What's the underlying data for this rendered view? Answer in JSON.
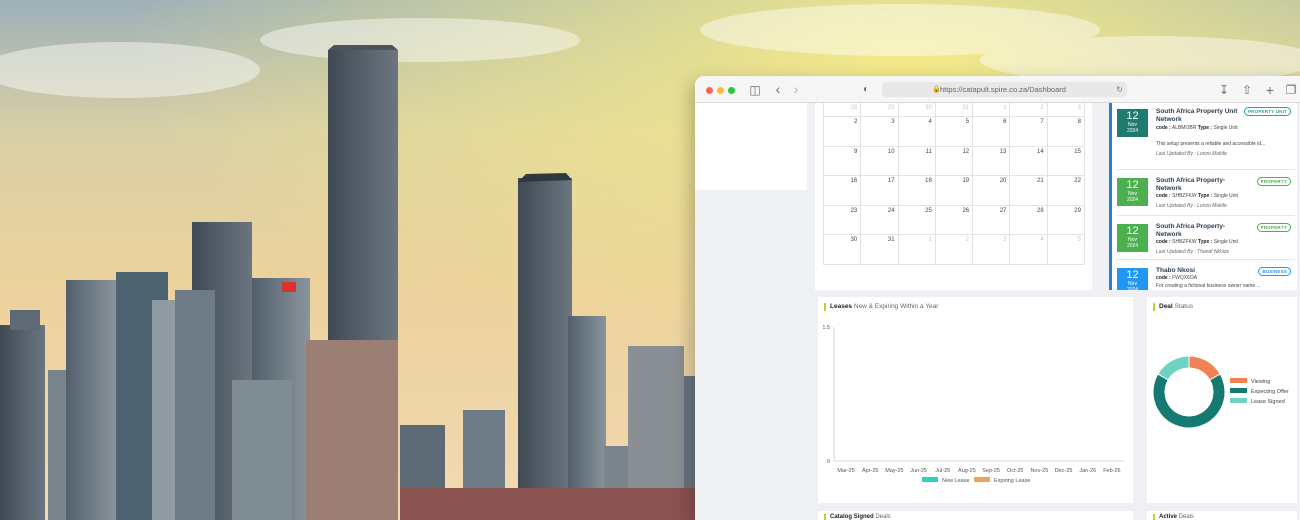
{
  "browser": {
    "url": "https://catapult.spire.co.za/Dashboard",
    "toolbar_icons": [
      "sidebar-icon",
      "back-icon",
      "forward-icon",
      "shield-icon",
      "download-icon",
      "share-icon",
      "plus-icon",
      "tabs-icon"
    ]
  },
  "calendar": {
    "rows": [
      [
        "28",
        "29",
        "30",
        "31",
        "1",
        "2",
        "3"
      ],
      [
        "2",
        "3",
        "4",
        "5",
        "6",
        "7",
        "8"
      ],
      [
        "9",
        "10",
        "11",
        "12",
        "13",
        "14",
        "15"
      ],
      [
        "16",
        "17",
        "18",
        "19",
        "20",
        "21",
        "22"
      ],
      [
        "23",
        "24",
        "25",
        "26",
        "27",
        "28",
        "29"
      ],
      [
        "30",
        "31",
        "1",
        "2",
        "3",
        "4",
        "5"
      ]
    ]
  },
  "activities": [
    {
      "day": "12",
      "month": "Nov",
      "year": "2024",
      "color": "#1e7b6f",
      "title": "South Africa Property Unit Network",
      "tag": "PROPERTY UNIT",
      "tag_color": "#2aa198",
      "code_label": "code :",
      "code": "ALBMOBR",
      "type_label": "Type :",
      "type": "Single Unit",
      "desc": "This setup presents a reliable and accessible id...",
      "updated": "Last Updated By : Lonzo Mokife"
    },
    {
      "day": "12",
      "month": "Nov",
      "year": "2024",
      "color": "#4caf50",
      "title": "South Africa Property-Network",
      "tag": "PROPERTY",
      "tag_color": "#4caf50",
      "code_label": "code :",
      "code": "SHBZFKW",
      "type_label": "Type :",
      "type": "Single Unit",
      "updated": "Last Updated By : Lonzo Mokife"
    },
    {
      "day": "12",
      "month": "Nov",
      "year": "2024",
      "color": "#4caf50",
      "title": "South Africa Property-Network",
      "tag": "PROPERTY",
      "tag_color": "#4caf50",
      "code_label": "code :",
      "code": "SHBZFKW",
      "type_label": "Type :",
      "type": "Single Unit",
      "updated": "Last Updated By : Thandi Nkhize"
    },
    {
      "day": "12",
      "month": "Nov",
      "year": "2024",
      "color": "#2196f3",
      "title": "Thabo Nkosi",
      "tag": "BUSINESS",
      "tag_color": "#2196f3",
      "code_label": "code :",
      "code": "FWQX6OA",
      "desc": "For creating a fictional business owner name ..."
    }
  ],
  "leases": {
    "title": "Leases",
    "subtitle": "New & Expiring Within a Year",
    "chart_data": {
      "type": "bar",
      "categories": [
        "Mar-25",
        "Apr-25",
        "May-25",
        "Jun-25",
        "Jul-25",
        "Aug-25",
        "Sep-25",
        "Oct-25",
        "Nov-25",
        "Dec-25",
        "Jan-26",
        "Feb-26"
      ],
      "series": [
        {
          "name": "New Lease",
          "values": [
            0,
            0,
            0,
            0,
            0,
            0,
            0,
            0,
            0,
            0,
            0,
            0
          ],
          "color": "#2ed1c0"
        },
        {
          "name": "Expiring Lease",
          "values": [
            0,
            0,
            0,
            0,
            0,
            0,
            0,
            0,
            0,
            0,
            0,
            0
          ],
          "color": "#f4a259"
        }
      ],
      "yticks": [
        "1.5",
        "0"
      ],
      "ylim": [
        0,
        1.5
      ]
    }
  },
  "deal": {
    "title": "Deal",
    "subtitle": "Status",
    "chart_data": {
      "type": "pie",
      "labels": [
        "Viewing",
        "Expecting Offer",
        "Lease Signed"
      ],
      "values": [
        1,
        4,
        1
      ],
      "colors": [
        "#ef8354",
        "#157a72",
        "#6fd3c4"
      ],
      "legend": "right"
    }
  },
  "bottom_cards": [
    {
      "title": "Catalog Signed",
      "subtitle": "Deals"
    },
    {
      "title": "Active",
      "subtitle": "Deals"
    }
  ]
}
